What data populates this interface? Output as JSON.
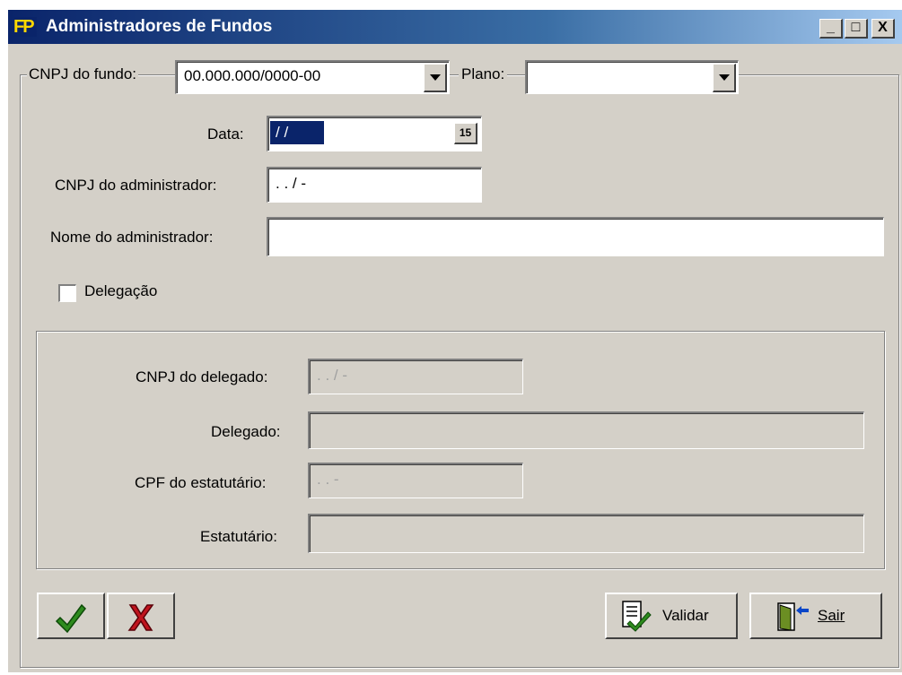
{
  "window": {
    "title": "Administradores de Fundos",
    "app_icon": "FP",
    "controls": [
      "_",
      "□",
      "X"
    ]
  },
  "top_group": {
    "cnpj_fundo_label": "CNPJ do fundo:",
    "cnpj_fundo_value": "00.000.000/0000-00",
    "plano_label": "Plano:",
    "plano_value": ""
  },
  "form": {
    "data_label": "Data:",
    "data_value": "/ /",
    "cal_icon_text": "15",
    "cnpj_admin_label": "CNPJ do administrador:",
    "cnpj_admin_value": ".  .  /  -",
    "nome_admin_label": "Nome do administrador:",
    "nome_admin_value": "",
    "delegacao_label": "Delegação",
    "delegacao_checked": false
  },
  "delegation_group": {
    "cnpj_delegado_label": "CNPJ do delegado:",
    "cnpj_delegado_value": ".  .  /  -",
    "delegado_label": "Delegado:",
    "delegado_value": "",
    "cpf_estatutario_label": "CPF do estatutário:",
    "cpf_estatutario_value": ".  .  -",
    "estatutario_label": "Estatutário:",
    "estatutario_value": ""
  },
  "buttons": {
    "validar_label": "Validar",
    "sair_label": "Sair"
  },
  "colors": {
    "confirm_icon": "#2e8b1e",
    "cancel_icon": "#c0141e"
  }
}
